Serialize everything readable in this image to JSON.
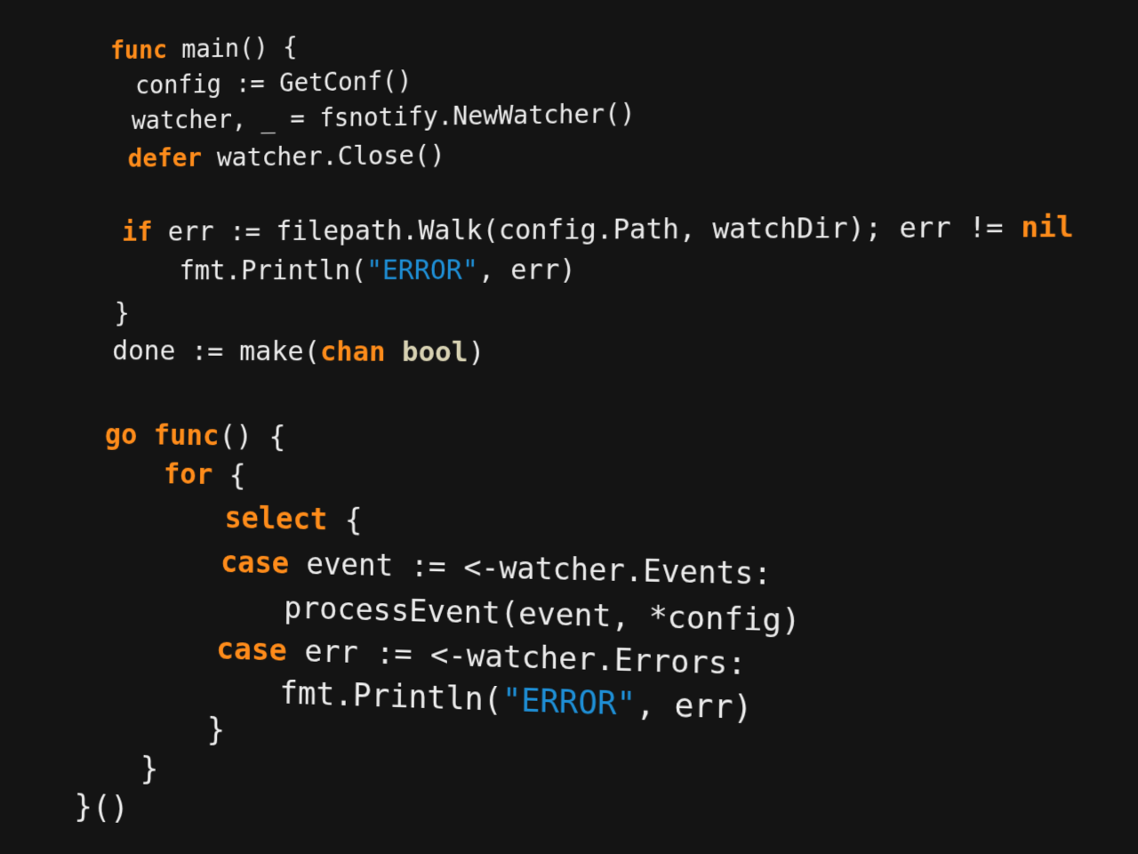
{
  "editor": {
    "background_color": "#141414",
    "colors": {
      "keyword": "#ff8c1a",
      "type": "#d8d2b3",
      "string": "#1e8fd6",
      "text": "#ececec"
    },
    "lines": [
      {
        "tokens": [
          {
            "t": "func",
            "c": "kw"
          },
          {
            "t": " main() {",
            "c": "txt"
          }
        ]
      },
      {
        "tokens": [
          {
            "t": "config := GetConf()",
            "c": "txt"
          }
        ]
      },
      {
        "tokens": [
          {
            "t": "watcher, _ = fsnotify.NewWatcher()",
            "c": "txt"
          }
        ]
      },
      {
        "tokens": [
          {
            "t": "defer",
            "c": "kw"
          },
          {
            "t": " watcher.Close()",
            "c": "txt"
          }
        ]
      },
      {
        "tokens": [
          {
            "t": "if",
            "c": "kw"
          },
          {
            "t": " err := filepath.Walk(config.Path, watchDir); err != ",
            "c": "txt"
          },
          {
            "t": "nil",
            "c": "kw"
          }
        ]
      },
      {
        "tokens": [
          {
            "t": "fmt.Println(",
            "c": "txt"
          },
          {
            "t": "\"ERROR\"",
            "c": "str"
          },
          {
            "t": ", err)",
            "c": "txt"
          }
        ]
      },
      {
        "tokens": [
          {
            "t": "}",
            "c": "txt"
          }
        ]
      },
      {
        "tokens": [
          {
            "t": "done := make(",
            "c": "txt"
          },
          {
            "t": "chan",
            "c": "kw"
          },
          {
            "t": " ",
            "c": "txt"
          },
          {
            "t": "bool",
            "c": "type"
          },
          {
            "t": ")",
            "c": "txt"
          }
        ]
      },
      {
        "tokens": [
          {
            "t": "go",
            "c": "kw"
          },
          {
            "t": " ",
            "c": "txt"
          },
          {
            "t": "func",
            "c": "kw"
          },
          {
            "t": "() {",
            "c": "txt"
          }
        ]
      },
      {
        "tokens": [
          {
            "t": "for",
            "c": "kw"
          },
          {
            "t": " {",
            "c": "txt"
          }
        ]
      },
      {
        "tokens": [
          {
            "t": "select",
            "c": "kw"
          },
          {
            "t": " {",
            "c": "txt"
          }
        ]
      },
      {
        "tokens": [
          {
            "t": "case",
            "c": "kw"
          },
          {
            "t": " event := <-watcher.Events:",
            "c": "txt"
          }
        ]
      },
      {
        "tokens": [
          {
            "t": "processEvent(event, *config)",
            "c": "txt"
          }
        ]
      },
      {
        "tokens": [
          {
            "t": "case",
            "c": "kw"
          },
          {
            "t": " err := <-watcher.Errors:",
            "c": "txt"
          }
        ]
      },
      {
        "tokens": [
          {
            "t": "fmt.Println(",
            "c": "txt"
          },
          {
            "t": "\"ERROR\"",
            "c": "str"
          },
          {
            "t": ", err)",
            "c": "txt"
          }
        ]
      },
      {
        "tokens": [
          {
            "t": "}",
            "c": "txt"
          }
        ]
      },
      {
        "tokens": [
          {
            "t": "}",
            "c": "txt"
          }
        ]
      },
      {
        "tokens": [
          {
            "t": "}()",
            "c": "txt"
          }
        ]
      }
    ]
  }
}
